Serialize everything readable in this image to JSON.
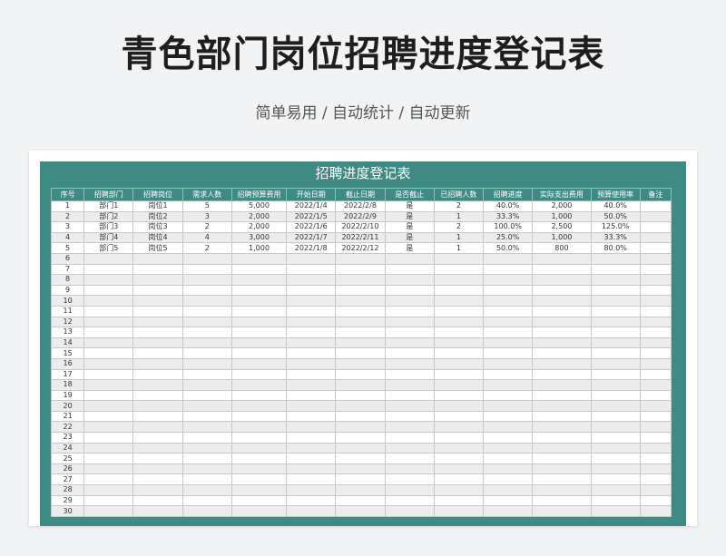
{
  "page": {
    "title": "青色部门岗位招聘进度登记表",
    "subtitle": "简单易用 / 自动统计 / 自动更新"
  },
  "sheet": {
    "title": "招聘进度登记表",
    "columns": [
      "序号",
      "招聘部门",
      "招聘岗位",
      "需求人数",
      "招聘预算费用",
      "开始日期",
      "截止日期",
      "是否截止",
      "已招聘人数",
      "招聘进度",
      "实际支出费用",
      "预算使用率",
      "备注"
    ],
    "rows": [
      [
        "1",
        "部门1",
        "岗位1",
        "5",
        "5,000",
        "2022/1/4",
        "2022/2/8",
        "是",
        "2",
        "40.0%",
        "2,000",
        "40.0%",
        ""
      ],
      [
        "2",
        "部门2",
        "岗位2",
        "3",
        "2,000",
        "2022/1/5",
        "2022/2/9",
        "是",
        "1",
        "33.3%",
        "1,000",
        "50.0%",
        ""
      ],
      [
        "3",
        "部门3",
        "岗位3",
        "2",
        "2,000",
        "2022/1/6",
        "2022/2/10",
        "是",
        "2",
        "100.0%",
        "2,500",
        "125.0%",
        ""
      ],
      [
        "4",
        "部门4",
        "岗位4",
        "4",
        "3,000",
        "2022/1/7",
        "2022/2/11",
        "是",
        "1",
        "25.0%",
        "1,000",
        "33.3%",
        ""
      ],
      [
        "5",
        "部门5",
        "岗位5",
        "2",
        "1,000",
        "2022/1/8",
        "2022/2/12",
        "是",
        "1",
        "50.0%",
        "800",
        "80.0%",
        ""
      ],
      [
        "6",
        "",
        "",
        "",
        "",
        "",
        "",
        "",
        "",
        "",
        "",
        "",
        ""
      ],
      [
        "7",
        "",
        "",
        "",
        "",
        "",
        "",
        "",
        "",
        "",
        "",
        "",
        ""
      ],
      [
        "8",
        "",
        "",
        "",
        "",
        "",
        "",
        "",
        "",
        "",
        "",
        "",
        ""
      ],
      [
        "9",
        "",
        "",
        "",
        "",
        "",
        "",
        "",
        "",
        "",
        "",
        "",
        ""
      ],
      [
        "10",
        "",
        "",
        "",
        "",
        "",
        "",
        "",
        "",
        "",
        "",
        "",
        ""
      ],
      [
        "11",
        "",
        "",
        "",
        "",
        "",
        "",
        "",
        "",
        "",
        "",
        "",
        ""
      ],
      [
        "12",
        "",
        "",
        "",
        "",
        "",
        "",
        "",
        "",
        "",
        "",
        "",
        ""
      ],
      [
        "13",
        "",
        "",
        "",
        "",
        "",
        "",
        "",
        "",
        "",
        "",
        "",
        ""
      ],
      [
        "14",
        "",
        "",
        "",
        "",
        "",
        "",
        "",
        "",
        "",
        "",
        "",
        ""
      ],
      [
        "15",
        "",
        "",
        "",
        "",
        "",
        "",
        "",
        "",
        "",
        "",
        "",
        ""
      ],
      [
        "16",
        "",
        "",
        "",
        "",
        "",
        "",
        "",
        "",
        "",
        "",
        "",
        ""
      ],
      [
        "17",
        "",
        "",
        "",
        "",
        "",
        "",
        "",
        "",
        "",
        "",
        "",
        ""
      ],
      [
        "18",
        "",
        "",
        "",
        "",
        "",
        "",
        "",
        "",
        "",
        "",
        "",
        ""
      ],
      [
        "19",
        "",
        "",
        "",
        "",
        "",
        "",
        "",
        "",
        "",
        "",
        "",
        ""
      ],
      [
        "20",
        "",
        "",
        "",
        "",
        "",
        "",
        "",
        "",
        "",
        "",
        "",
        ""
      ],
      [
        "21",
        "",
        "",
        "",
        "",
        "",
        "",
        "",
        "",
        "",
        "",
        "",
        ""
      ],
      [
        "22",
        "",
        "",
        "",
        "",
        "",
        "",
        "",
        "",
        "",
        "",
        "",
        ""
      ],
      [
        "23",
        "",
        "",
        "",
        "",
        "",
        "",
        "",
        "",
        "",
        "",
        "",
        ""
      ],
      [
        "24",
        "",
        "",
        "",
        "",
        "",
        "",
        "",
        "",
        "",
        "",
        "",
        ""
      ],
      [
        "25",
        "",
        "",
        "",
        "",
        "",
        "",
        "",
        "",
        "",
        "",
        "",
        ""
      ],
      [
        "26",
        "",
        "",
        "",
        "",
        "",
        "",
        "",
        "",
        "",
        "",
        "",
        ""
      ],
      [
        "27",
        "",
        "",
        "",
        "",
        "",
        "",
        "",
        "",
        "",
        "",
        "",
        ""
      ],
      [
        "28",
        "",
        "",
        "",
        "",
        "",
        "",
        "",
        "",
        "",
        "",
        "",
        ""
      ],
      [
        "29",
        "",
        "",
        "",
        "",
        "",
        "",
        "",
        "",
        "",
        "",
        "",
        ""
      ],
      [
        "30",
        "",
        "",
        "",
        "",
        "",
        "",
        "",
        "",
        "",
        "",
        "",
        ""
      ]
    ]
  },
  "colors": {
    "accent": "#3f8a85",
    "alt_row": "#ececec",
    "background": "#f1f3f4"
  }
}
